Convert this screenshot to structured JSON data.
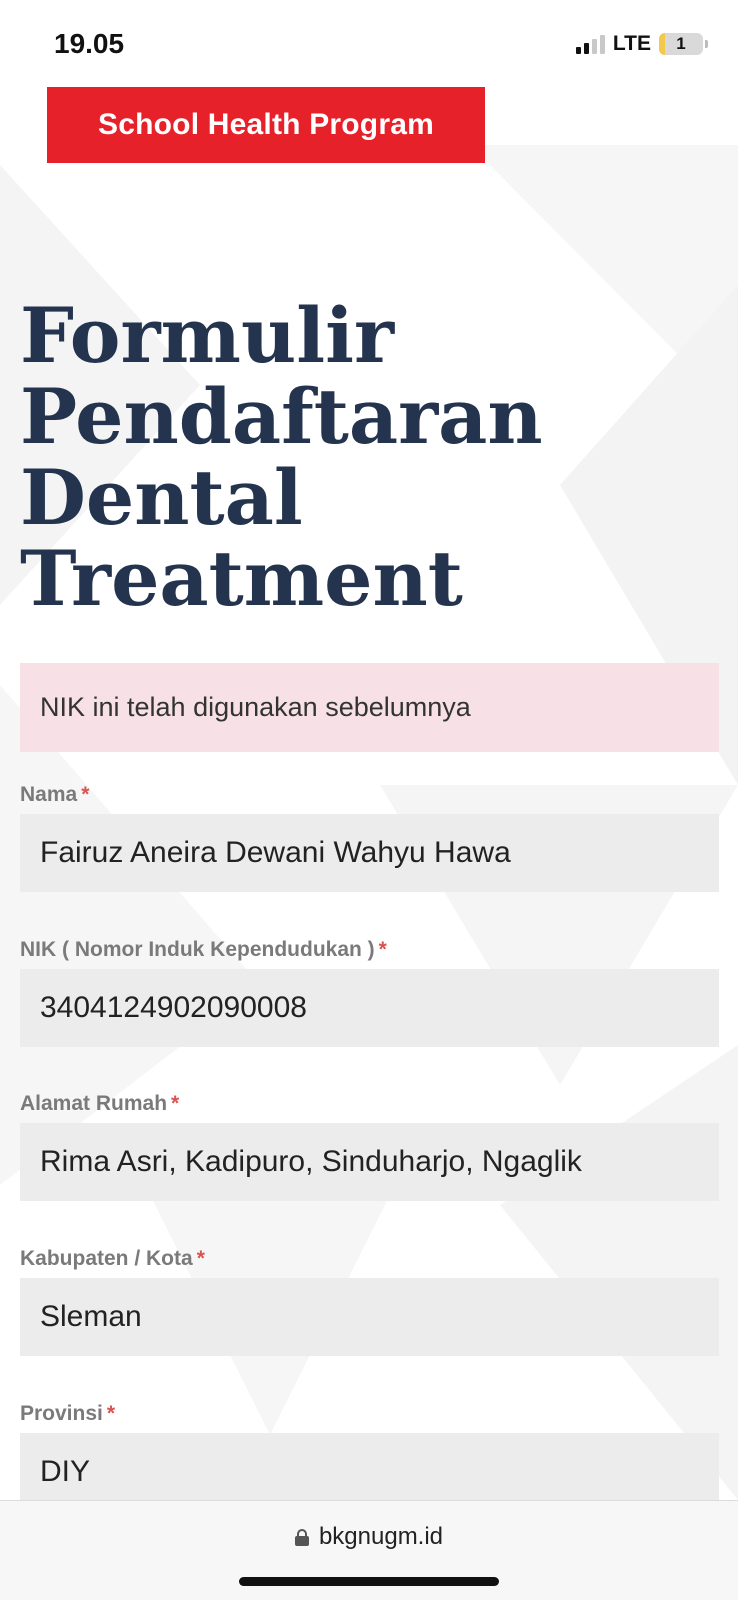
{
  "status_bar": {
    "time": "19.05",
    "network": "LTE",
    "battery": "1"
  },
  "banner": {
    "text": "School Health Program"
  },
  "page_title": "Formulir Pendaftaran Dental Treatment",
  "alert": {
    "message": "NIK ini telah digunakan sebelumnya"
  },
  "form": {
    "required_mark": "*",
    "fields": [
      {
        "label": "Nama",
        "value": "Fairuz Aneira Dewani Wahyu Hawa"
      },
      {
        "label": "NIK ( Nomor Induk Kependudukan )",
        "value": "3404124902090008"
      },
      {
        "label": "Alamat Rumah",
        "value": "Rima Asri, Kadipuro, Sinduharjo, Ngaglik"
      },
      {
        "label": "Kabupaten / Kota",
        "value": "Sleman"
      },
      {
        "label": "Provinsi",
        "value": "DIY"
      }
    ]
  },
  "url_bar": {
    "domain": "bkgnugm.id"
  },
  "colors": {
    "banner": "#e62129",
    "title": "#24344f",
    "alert_bg": "#f8e1e6",
    "input_bg": "#ececec",
    "required": "#d9534f"
  }
}
